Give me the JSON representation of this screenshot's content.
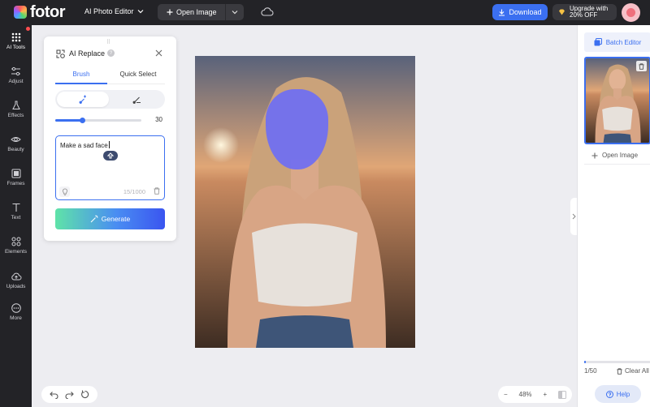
{
  "app": {
    "brand": "fotor",
    "mode_label": "AI Photo Editor",
    "open_image_label": "Open Image",
    "download_label": "Download",
    "upgrade_line1": "Upgrade with",
    "upgrade_line2": "20% OFF",
    "accent_color": "#3b6ff0"
  },
  "sidebar": {
    "items": [
      {
        "label": "AI Tools",
        "icon": "grid-icon"
      },
      {
        "label": "Adjust",
        "icon": "sliders-icon"
      },
      {
        "label": "Effects",
        "icon": "flask-icon"
      },
      {
        "label": "Beauty",
        "icon": "eye-icon"
      },
      {
        "label": "Frames",
        "icon": "frame-icon"
      },
      {
        "label": "Text",
        "icon": "text-icon"
      },
      {
        "label": "Elements",
        "icon": "shapes-icon"
      },
      {
        "label": "Uploads",
        "icon": "cloud-upload-icon"
      },
      {
        "label": "More",
        "icon": "more-icon"
      }
    ]
  },
  "panel": {
    "title": "AI Replace",
    "tabs": [
      "Brush",
      "Quick Select"
    ],
    "active_tab": "Brush",
    "brush_size": 30,
    "brush_fraction": 0.31,
    "prompt_text": "Make a sad face",
    "char_count": "15/1000",
    "generate_label": "Generate"
  },
  "zoom": {
    "value": "48%"
  },
  "right_panel": {
    "batch_label": "Batch Editor",
    "open_image_label": "Open Image",
    "count": "1/50",
    "progress_fraction": 0.02,
    "clear_label": "Clear All"
  },
  "help_label": "Help"
}
